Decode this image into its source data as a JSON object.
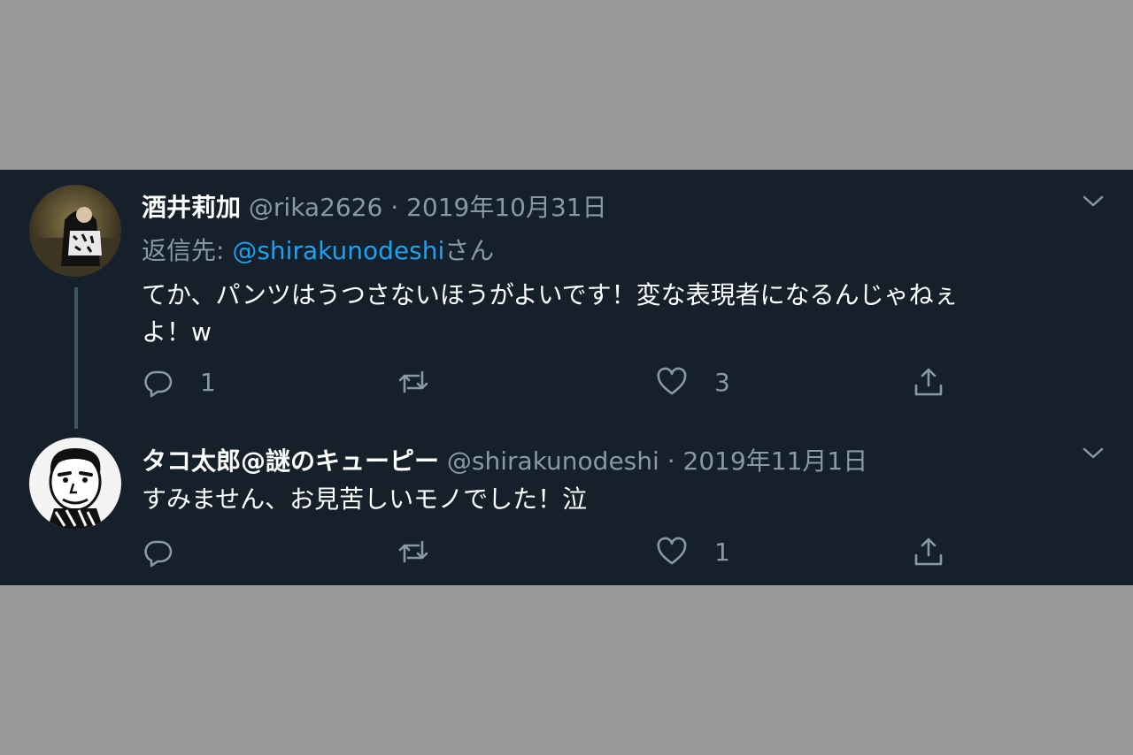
{
  "tweets": [
    {
      "display_name": "酒井莉加",
      "handle": "@rika2626",
      "separator": "·",
      "date": "2019年10月31日",
      "reply_prefix": "返信先: ",
      "reply_to": "@shirakunodeshi",
      "reply_suffix": "さん",
      "text_line1": "てか、パンツはうつさないほうがよいです！変な表現者になるんじゃねぇ",
      "text_line2": "よ！w",
      "reply_count": "1",
      "retweet_count": "",
      "like_count": "3",
      "avatar_icon": "user-avatar-photo"
    },
    {
      "display_name": "タコ太郎@謎のキューピー",
      "handle": "@shirakunodeshi",
      "separator": "·",
      "date": "2019年11月1日",
      "text_line1": "すみません、お見苦しいモノでした！泣",
      "reply_count": "",
      "retweet_count": "",
      "like_count": "1",
      "avatar_icon": "cartoon-face-avatar"
    }
  ],
  "colors": {
    "page_background": "#999999",
    "panel_background": "#15202b",
    "text_primary": "#ffffff",
    "text_muted": "#8899a6",
    "link": "#1da1f2",
    "thread_line": "#3d5466"
  },
  "icons": [
    "reply-icon",
    "retweet-icon",
    "like-icon",
    "share-icon",
    "chevron-down-icon"
  ]
}
